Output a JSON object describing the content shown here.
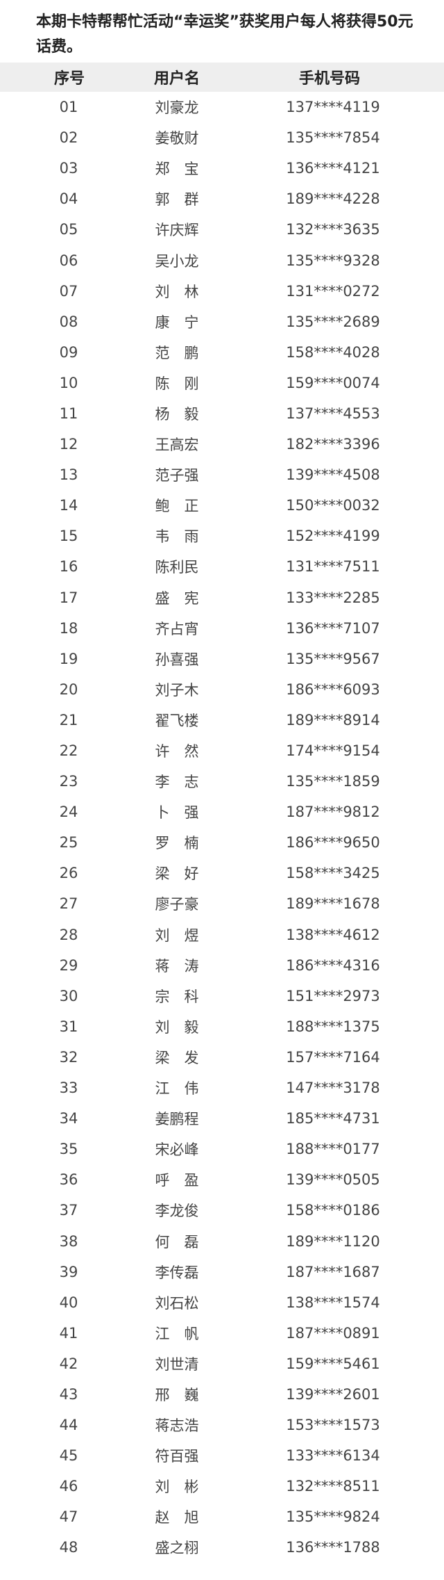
{
  "intro": {
    "text": "本期卡特帮帮忙活动“幸运奖”获奖用户每人将获得50元话费。"
  },
  "table": {
    "headers": [
      "序号",
      "用户名",
      "手机号码"
    ],
    "rows": [
      [
        "01",
        "刘豪龙",
        "137****4119"
      ],
      [
        "02",
        "姜敬财",
        "135****7854"
      ],
      [
        "03",
        "郑　宝",
        "136****4121"
      ],
      [
        "04",
        "郭　群",
        "189****4228"
      ],
      [
        "05",
        "许庆辉",
        "132****3635"
      ],
      [
        "06",
        "吴小龙",
        "135****9328"
      ],
      [
        "07",
        "刘　林",
        "131****0272"
      ],
      [
        "08",
        "康　宁",
        "135****2689"
      ],
      [
        "09",
        "范　鹏",
        "158****4028"
      ],
      [
        "10",
        "陈　刚",
        "159****0074"
      ],
      [
        "11",
        "杨　毅",
        "137****4553"
      ],
      [
        "12",
        "王高宏",
        "182****3396"
      ],
      [
        "13",
        "范子强",
        "139****4508"
      ],
      [
        "14",
        "鲍　正",
        "150****0032"
      ],
      [
        "15",
        "韦　雨",
        "152****4199"
      ],
      [
        "16",
        "陈利民",
        "131****7511"
      ],
      [
        "17",
        "盛　宪",
        "133****2285"
      ],
      [
        "18",
        "齐占宵",
        "136****7107"
      ],
      [
        "19",
        "孙喜强",
        "135****9567"
      ],
      [
        "20",
        "刘子木",
        "186****6093"
      ],
      [
        "21",
        "翟飞楼",
        "189****8914"
      ],
      [
        "22",
        "许　然",
        "174****9154"
      ],
      [
        "23",
        "李　志",
        "135****1859"
      ],
      [
        "24",
        "卜　强",
        "187****9812"
      ],
      [
        "25",
        "罗　楠",
        "186****9650"
      ],
      [
        "26",
        "梁　好",
        "158****3425"
      ],
      [
        "27",
        "廖子豪",
        "189****1678"
      ],
      [
        "28",
        "刘　煜",
        "138****4612"
      ],
      [
        "29",
        "蒋　涛",
        "186****4316"
      ],
      [
        "30",
        "宗　科",
        "151****2973"
      ],
      [
        "31",
        "刘　毅",
        "188****1375"
      ],
      [
        "32",
        "梁　发",
        "157****7164"
      ],
      [
        "33",
        "江　伟",
        "147****3178"
      ],
      [
        "34",
        "姜鹏程",
        "185****4731"
      ],
      [
        "35",
        "宋必峰",
        "188****0177"
      ],
      [
        "36",
        "呼　盈",
        "139****0505"
      ],
      [
        "37",
        "李龙俊",
        "158****0186"
      ],
      [
        "38",
        "何　磊",
        "189****1120"
      ],
      [
        "39",
        "李传磊",
        "187****1687"
      ],
      [
        "40",
        "刘石松",
        "138****1574"
      ],
      [
        "41",
        "江　帆",
        "187****0891"
      ],
      [
        "42",
        "刘世清",
        "159****5461"
      ],
      [
        "43",
        "邢　巍",
        "139****2601"
      ],
      [
        "44",
        "蒋志浩",
        "153****1573"
      ],
      [
        "45",
        "符百强",
        "133****6134"
      ],
      [
        "46",
        "刘　彬",
        "132****8511"
      ],
      [
        "47",
        "赵　旭",
        "135****9824"
      ],
      [
        "48",
        "盛之栩",
        "136****1788"
      ]
    ]
  }
}
